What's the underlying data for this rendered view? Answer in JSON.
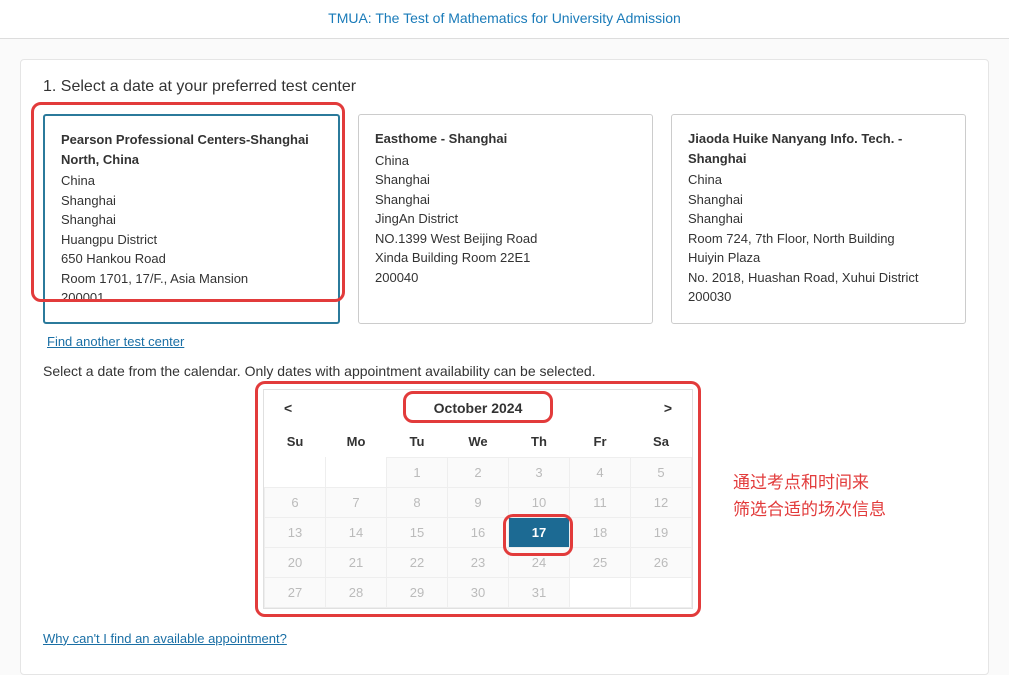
{
  "header": {
    "title": "TMUA: The Test of Mathematics for University Admission"
  },
  "section": {
    "heading": "1. Select a date at your preferred test center"
  },
  "centers": [
    {
      "name": "Pearson Professional Centers-Shanghai North, China",
      "lines": [
        "China",
        "Shanghai",
        "Shanghai",
        "Huangpu District",
        "650 Hankou Road",
        "Room 1701, 17/F., Asia Mansion",
        "200001"
      ],
      "selected": true
    },
    {
      "name": "Easthome - Shanghai",
      "lines": [
        "China",
        "Shanghai",
        "Shanghai",
        "JingAn District",
        "NO.1399 West Beijing Road",
        "Xinda Building Room 22E1",
        "200040"
      ],
      "selected": false
    },
    {
      "name": "Jiaoda Huike Nanyang Info. Tech. - Shanghai",
      "lines": [
        "China",
        "Shanghai",
        "Shanghai",
        "Room 724, 7th Floor, North Building",
        "Huiyin Plaza",
        "No. 2018, Huashan Road, Xuhui District",
        "200030"
      ],
      "selected": false
    }
  ],
  "links": {
    "find_another": "Find another test center",
    "why_unavailable": "Why can't I find an available appointment?"
  },
  "instruction": "Select a date from the calendar. Only dates with appointment availability can be selected.",
  "calendar": {
    "prev": "<",
    "next": ">",
    "month_label": "October 2024",
    "weekdays": [
      "Su",
      "Mo",
      "Tu",
      "We",
      "Th",
      "Fr",
      "Sa"
    ],
    "weeks": [
      [
        null,
        null,
        1,
        2,
        3,
        4,
        5
      ],
      [
        6,
        7,
        8,
        9,
        10,
        11,
        12
      ],
      [
        13,
        14,
        15,
        16,
        17,
        18,
        19
      ],
      [
        20,
        21,
        22,
        23,
        24,
        25,
        26
      ],
      [
        27,
        28,
        29,
        30,
        31,
        null,
        null
      ]
    ],
    "selected_day": 17
  },
  "annotation": {
    "line1": "通过考点和时间来",
    "line2": "筛选合适的场次信息"
  }
}
